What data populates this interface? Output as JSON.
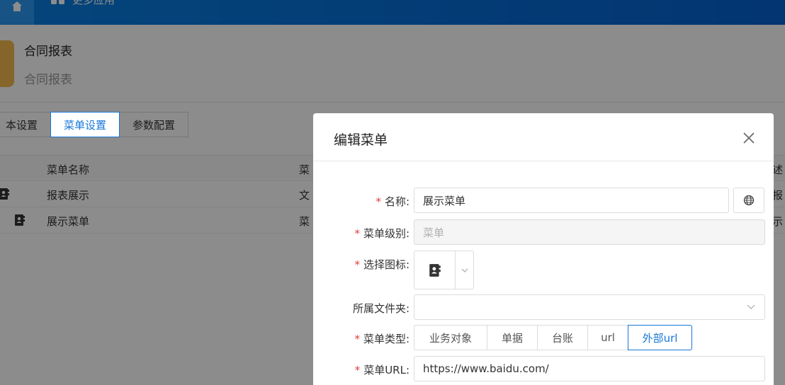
{
  "topbar": {
    "more_apps_label": "更多应用"
  },
  "app": {
    "title": "合同报表",
    "subtitle": "合同报表"
  },
  "tabs": [
    {
      "label": "基本设置",
      "visible_label": "本设置",
      "active": false
    },
    {
      "label": "菜单设置",
      "active": true
    },
    {
      "label": "参数配置",
      "active": false
    }
  ],
  "bg_table": {
    "headers": {
      "name": "菜单名称",
      "type": "菜",
      "desc": "述"
    },
    "rows": [
      {
        "name": "报表展示",
        "type": "文",
        "desc": "报"
      },
      {
        "name": "展示菜单",
        "type": "菜",
        "desc": "示"
      }
    ]
  },
  "modal": {
    "title": "编辑菜单",
    "fields": {
      "name": {
        "label": "名称:",
        "value": "展示菜单",
        "required": true
      },
      "level": {
        "label": "菜单级别:",
        "placeholder": "菜单",
        "required": true
      },
      "icon": {
        "label": "选择图标:",
        "required": true,
        "icon_name": "contacts-book-icon"
      },
      "folder": {
        "label": "所属文件夹:",
        "value": "",
        "required": false
      },
      "type": {
        "label": "菜单类型:",
        "required": true,
        "options": [
          "业务对象",
          "单据",
          "台账",
          "url",
          "外部url"
        ],
        "selected": "外部url"
      },
      "url": {
        "label": "菜单URL:",
        "value": "https://www.baidu.com/",
        "required": true
      }
    }
  },
  "colors": {
    "topbar": "#0a7fe0",
    "accent": "#1677d9",
    "required": "#e43b3b",
    "app_icon": "#f4b94e"
  }
}
